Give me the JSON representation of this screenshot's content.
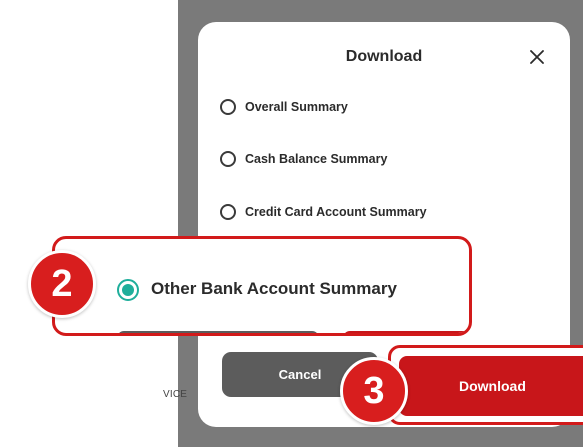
{
  "dialog": {
    "title": "Download",
    "options": [
      {
        "label": "Overall Summary",
        "selected": false
      },
      {
        "label": "Cash Balance Summary",
        "selected": false
      },
      {
        "label": "Credit Card Account Summary",
        "selected": false
      },
      {
        "label": "Other Bank Account Summary",
        "selected": true
      }
    ],
    "cancel_label": "Cancel",
    "download_label": "Download"
  },
  "footer_fragment": "VICE",
  "callouts": {
    "step_2": "2",
    "step_3": "3"
  },
  "colors": {
    "accent_red": "#c8161a",
    "highlight_border": "#d21a1a",
    "radio_selected": "#1fae9b",
    "cancel_gray": "#5c5c5c",
    "backdrop": "#7a7a7a"
  },
  "icons": {
    "close": "close-icon"
  }
}
